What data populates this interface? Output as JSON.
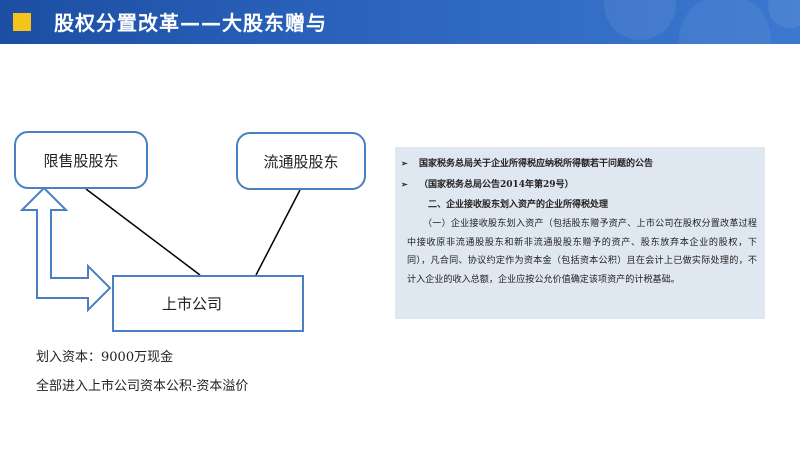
{
  "header": {
    "title": "股权分置改革——大股东赠与"
  },
  "diagram": {
    "box_restricted": "限售股股东",
    "box_circulating": "流通股股东",
    "box_listed": "上市公司"
  },
  "notes": {
    "capital_transfer": "划入资本：9000万现金",
    "capital_reserve": "全部进入上市公司资本公积-资本溢价"
  },
  "panel": {
    "bullet1": "国家税务总局关于企业所得税应纳税所得额若干问题的公告",
    "bullet2": "（国家税务总局公告2014年第29号）",
    "subheading": "二、企业接收股东划入资产的企业所得税处理",
    "paragraph": "（一）企业接收股东划入资产（包括股东赠予资产、上市公司在股权分置改革过程中接收原非流通股股东和新非流通股股东赠予的资产、股东放弃本企业的股权，下同），凡合同、协议约定作为资本金（包括资本公积）且在会计上已做实际处理的，不计入企业的收入总额，企业应按公允价值确定该项资产的计税基础。"
  },
  "colors": {
    "header_blue": "#2b63bd",
    "accent_yellow": "#f6c21c",
    "border_blue": "#4a7fc4",
    "panel_bg": "#dfe7f1"
  }
}
